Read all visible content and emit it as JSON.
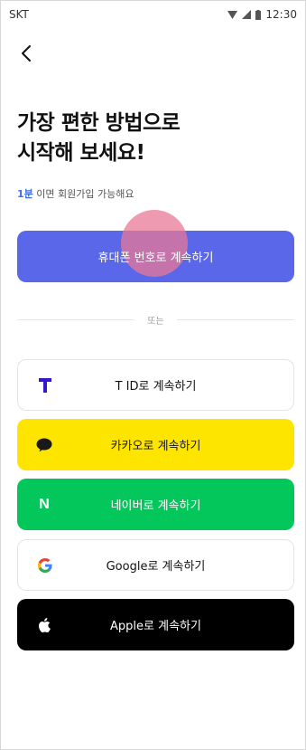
{
  "status_bar": {
    "carrier": "SKT",
    "time": "12:30"
  },
  "header": {
    "back_label": "back"
  },
  "title": {
    "text": "가장 편한 방법으로\n시작해 보세요!"
  },
  "subtitle": {
    "highlight": "1분",
    "rest": " 이면 회원가입 가능해요"
  },
  "buttons": {
    "phone": "휴대폰 번호로 계속하기",
    "divider": "또는",
    "tid": "T ID로 계속하기",
    "kakao": "카카오로 계속하기",
    "naver": "네이버로 계속하기",
    "google": "Google로 계속하기",
    "apple": "Apple로 계속하기"
  },
  "icons": {
    "tid": "tid-logo-icon",
    "kakao": "kakao-bubble-icon",
    "naver": "naver-n-icon",
    "naver_letter": "N",
    "google": "google-g-icon",
    "apple": "apple-logo-icon"
  },
  "colors": {
    "primary": "#5a67e9",
    "kakao": "#fee500",
    "naver": "#03c75a",
    "apple": "#000000",
    "highlight": "#3b6de6",
    "tid": "#3617ce"
  }
}
